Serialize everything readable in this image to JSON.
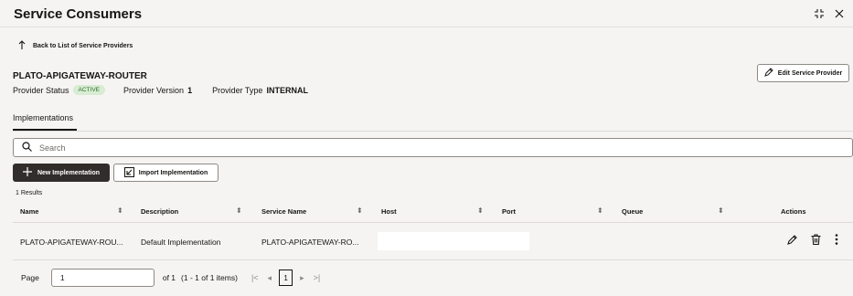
{
  "header": {
    "title": "Service Consumers"
  },
  "back_link": "Back to List of Service Providers",
  "provider": {
    "name": "PLATO-APIGATEWAY-ROUTER",
    "status_label": "Provider Status",
    "status_badge": "ACTIVE",
    "version_label": "Provider Version",
    "version_value": "1",
    "type_label": "Provider Type",
    "type_value": "INTERNAL"
  },
  "edit_button": "Edit Service Provider",
  "tabs": [
    {
      "label": "Implementations"
    }
  ],
  "search": {
    "placeholder": "Search",
    "value": ""
  },
  "toolbar": {
    "new_label": "New Implementation",
    "import_label": "Import Implementation"
  },
  "results_text": "1 Results",
  "table": {
    "columns": [
      "Name",
      "Description",
      "Service Name",
      "Host",
      "Port",
      "Queue",
      "Actions"
    ],
    "rows": [
      {
        "name": "PLATO-APIGATEWAY-ROU...",
        "description": "Default Implementation",
        "service_name": "PLATO-APIGATEWAY-RO...",
        "host": "",
        "port": "",
        "queue": ""
      }
    ]
  },
  "pagination": {
    "page_label": "Page",
    "page_value": "1",
    "of_text": "of 1",
    "items_text": "(1 - 1 of 1 items)",
    "current": "1"
  },
  "icons": [
    "collapse-icon",
    "close-icon",
    "arrow-up-icon",
    "pencil-icon",
    "search-icon",
    "plus-icon",
    "import-icon",
    "sort-icon",
    "trash-icon",
    "more-vertical-icon",
    "first-page-icon",
    "prev-page-icon",
    "next-page-icon",
    "last-page-icon"
  ],
  "colors": {
    "primary_button": "#312d2a",
    "badge_bg": "#d8ecd3",
    "badge_text": "#2f6f2c",
    "page_bg": "#f5f4f2"
  }
}
